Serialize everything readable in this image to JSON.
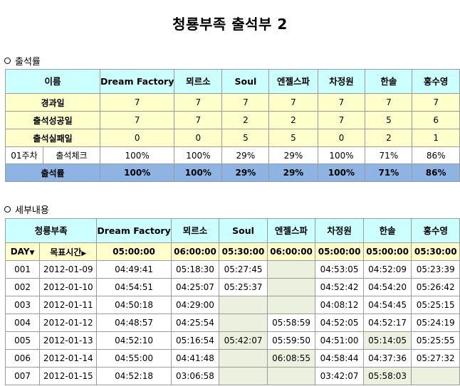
{
  "title": "청룡부족 출석부 2",
  "section1": {
    "label": "출석률"
  },
  "section2": {
    "label": "세부내용"
  },
  "attendance": {
    "header_label": "이름",
    "members": [
      "Dream Factory",
      "뫼르소",
      "Soul",
      "엔젤스파",
      "차정원",
      "한솔",
      "홍수영"
    ],
    "rows": [
      {
        "label": "경과일",
        "values": [
          "7",
          "7",
          "7",
          "7",
          "7",
          "7",
          "7"
        ]
      },
      {
        "label": "출석성공일",
        "values": [
          "7",
          "7",
          "2",
          "2",
          "7",
          "5",
          "6"
        ]
      },
      {
        "label": "출석실패일",
        "values": [
          "0",
          "0",
          "5",
          "5",
          "0",
          "2",
          "1"
        ]
      }
    ],
    "week_row": {
      "week": "01주차",
      "label": "출석체크",
      "values": [
        "100%",
        "100%",
        "29%",
        "29%",
        "100%",
        "71%",
        "86%"
      ]
    },
    "rate_row": {
      "label": "출석률",
      "values": [
        "100%",
        "100%",
        "29%",
        "29%",
        "100%",
        "71%",
        "86%"
      ]
    }
  },
  "detail": {
    "header_label": "청룡부족",
    "members": [
      "Dream Factory",
      "뫼르소",
      "Soul",
      "엔젤스파",
      "차정원",
      "한솔",
      "홍수영"
    ],
    "day_label": "DAY",
    "target_label": "목표시간",
    "targets": [
      "05:00:00",
      "06:00:00",
      "05:30:00",
      "06:00:00",
      "05:00:00",
      "05:00:00",
      "05:30:00"
    ],
    "rows": [
      {
        "day": "001",
        "date": "2012-01-09",
        "times": [
          "04:49:41",
          "05:18:30",
          "05:27:45",
          "",
          "04:53:05",
          "04:52:09",
          "05:23:39"
        ]
      },
      {
        "day": "002",
        "date": "2012-01-10",
        "times": [
          "04:54:51",
          "04:25:07",
          "05:25:37",
          "",
          "04:52:42",
          "04:54:20",
          "05:26:42"
        ]
      },
      {
        "day": "003",
        "date": "2012-01-11",
        "times": [
          "04:50:18",
          "04:29:00",
          "",
          "",
          "04:08:12",
          "04:54:45",
          "05:25:15"
        ]
      },
      {
        "day": "004",
        "date": "2012-01-12",
        "times": [
          "04:48:57",
          "04:25:54",
          "",
          "05:58:59",
          "04:52:05",
          "04:52:17",
          "05:24:19"
        ]
      },
      {
        "day": "005",
        "date": "2012-01-13",
        "times": [
          "04:52:10",
          "05:16:54",
          "05:42:07",
          "05:59:50",
          "04:51:00",
          "05:14:05",
          "05:25:55"
        ]
      },
      {
        "day": "006",
        "date": "2012-01-14",
        "times": [
          "04:55:00",
          "04:41:48",
          "",
          "06:08:55",
          "04:58:44",
          "04:37:36",
          "05:27:32"
        ]
      },
      {
        "day": "007",
        "date": "2012-01-15",
        "times": [
          "04:52:18",
          "03:06:58",
          "",
          "",
          "03:42:07",
          "05:58:03",
          ""
        ]
      }
    ]
  },
  "colors": {
    "header_bg": "#ccffff",
    "yellow_bg": "#ffffcc",
    "rate_bg": "#8db4e2",
    "late_bg": "#ebf1de"
  }
}
